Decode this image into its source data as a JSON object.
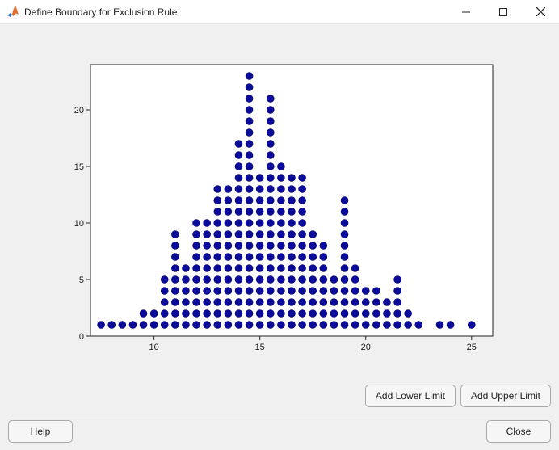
{
  "window": {
    "title": "Define Boundary for Exclusion Rule"
  },
  "buttons": {
    "add_lower": "Add Lower Limit",
    "add_upper": "Add Upper Limit",
    "help": "Help",
    "close": "Close"
  },
  "chart_data": {
    "type": "scatter",
    "title": "",
    "xlabel": "",
    "ylabel": "",
    "xlim": [
      7,
      26
    ],
    "ylim": [
      0,
      24
    ],
    "xticks": [
      10,
      15,
      20,
      25
    ],
    "yticks": [
      0,
      5,
      10,
      15,
      20
    ],
    "legend": null,
    "marker": {
      "shape": "circle",
      "size": 9,
      "fill": "#0b0b9b",
      "edge": "#00006b"
    },
    "columns": [
      {
        "x": 7.5,
        "count": 1
      },
      {
        "x": 8.0,
        "count": 1
      },
      {
        "x": 8.5,
        "count": 1
      },
      {
        "x": 9.0,
        "count": 1
      },
      {
        "x": 9.5,
        "count": 2
      },
      {
        "x": 10.0,
        "count": 2
      },
      {
        "x": 10.5,
        "count": 5
      },
      {
        "x": 11.0,
        "count": 9
      },
      {
        "x": 11.5,
        "count": 6
      },
      {
        "x": 12.0,
        "count": 10
      },
      {
        "x": 12.5,
        "count": 10
      },
      {
        "x": 13.0,
        "count": 13
      },
      {
        "x": 13.5,
        "count": 13
      },
      {
        "x": 14.0,
        "count": 17
      },
      {
        "x": 14.5,
        "count": 23
      },
      {
        "x": 15.0,
        "count": 14
      },
      {
        "x": 15.5,
        "count": 21
      },
      {
        "x": 16.0,
        "count": 15
      },
      {
        "x": 16.5,
        "count": 14
      },
      {
        "x": 17.0,
        "count": 14
      },
      {
        "x": 17.5,
        "count": 9
      },
      {
        "x": 18.0,
        "count": 8
      },
      {
        "x": 18.5,
        "count": 5
      },
      {
        "x": 19.0,
        "count": 12
      },
      {
        "x": 19.5,
        "count": 6
      },
      {
        "x": 20.0,
        "count": 4
      },
      {
        "x": 20.5,
        "count": 4
      },
      {
        "x": 21.0,
        "count": 3
      },
      {
        "x": 21.5,
        "count": 5
      },
      {
        "x": 22.0,
        "count": 2
      },
      {
        "x": 22.5,
        "count": 1
      },
      {
        "x": 23.5,
        "count": 1
      },
      {
        "x": 24.0,
        "count": 1
      },
      {
        "x": 25.0,
        "count": 1
      }
    ]
  }
}
